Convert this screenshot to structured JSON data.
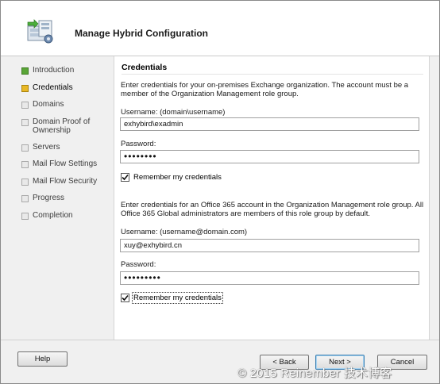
{
  "window": {
    "title": "Manage Hybrid Configuration",
    "icon": "hybrid-config-icon"
  },
  "nav": {
    "items": [
      {
        "label": "Introduction",
        "state": "done"
      },
      {
        "label": "Credentials",
        "state": "current"
      },
      {
        "label": "Domains",
        "state": "pending"
      },
      {
        "label": "Domain Proof of Ownership",
        "state": "pending"
      },
      {
        "label": "Servers",
        "state": "pending"
      },
      {
        "label": "Mail Flow Settings",
        "state": "pending"
      },
      {
        "label": "Mail Flow Security",
        "state": "pending"
      },
      {
        "label": "Progress",
        "state": "pending"
      },
      {
        "label": "Completion",
        "state": "pending"
      }
    ]
  },
  "content": {
    "title": "Credentials",
    "onprem": {
      "description": "Enter credentials for your on-premises Exchange organization. The account must be a member of the Organization Management role group.",
      "username_label": "Username: (domain\\username)",
      "username_value": "exhybird\\exadmin",
      "password_label": "Password:",
      "password_mask": "••••••••",
      "remember_label": "Remember my credentials",
      "remember_checked": true
    },
    "cloud": {
      "description": "Enter credentials for an Office 365 account in the Organization Management role group. All Office 365 Global administrators are members of this role group by default.",
      "username_label": "Username: (username@domain.com)",
      "username_value": "xuy@exhybird.cn",
      "password_label": "Password:",
      "password_mask": "•••••••••",
      "remember_label": "Remember my credentials",
      "remember_checked": true
    }
  },
  "buttons": {
    "help": "Help",
    "back": "< Back",
    "next": "Next >",
    "cancel": "Cancel"
  },
  "watermark": "© 2015 Reinember 技术博客",
  "colors": {
    "done": "#5aa637",
    "current": "#e9b825",
    "pending": "#e9e9e9",
    "default_button_border": "#3c7fb1"
  }
}
